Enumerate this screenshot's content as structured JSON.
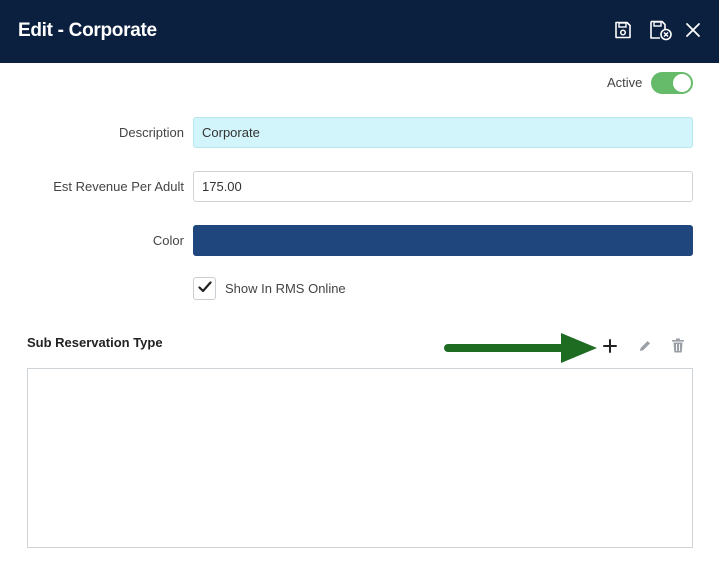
{
  "header": {
    "title": "Edit - Corporate"
  },
  "form": {
    "active_label": "Active",
    "active": true,
    "description": {
      "label": "Description",
      "value": "Corporate"
    },
    "est_revenue": {
      "label": "Est Revenue Per Adult",
      "value": "175.00"
    },
    "color": {
      "label": "Color",
      "value": "#1f467d"
    },
    "show_online": {
      "label": "Show In RMS Online",
      "checked": true
    }
  },
  "sub_reservation": {
    "title": "Sub Reservation Type",
    "rows": []
  },
  "colors": {
    "header_bg": "#0b1f3f",
    "toggle_on": "#66bb6a",
    "description_bg": "#d2f5fb",
    "annotation_arrow": "#1e6b22"
  },
  "icons": {
    "save": "save-icon",
    "save_close": "save-close-icon",
    "close": "close-icon",
    "add": "plus-icon",
    "edit": "pencil-icon",
    "delete": "trash-icon",
    "check": "check-icon",
    "annotation": "arrow-icon"
  }
}
